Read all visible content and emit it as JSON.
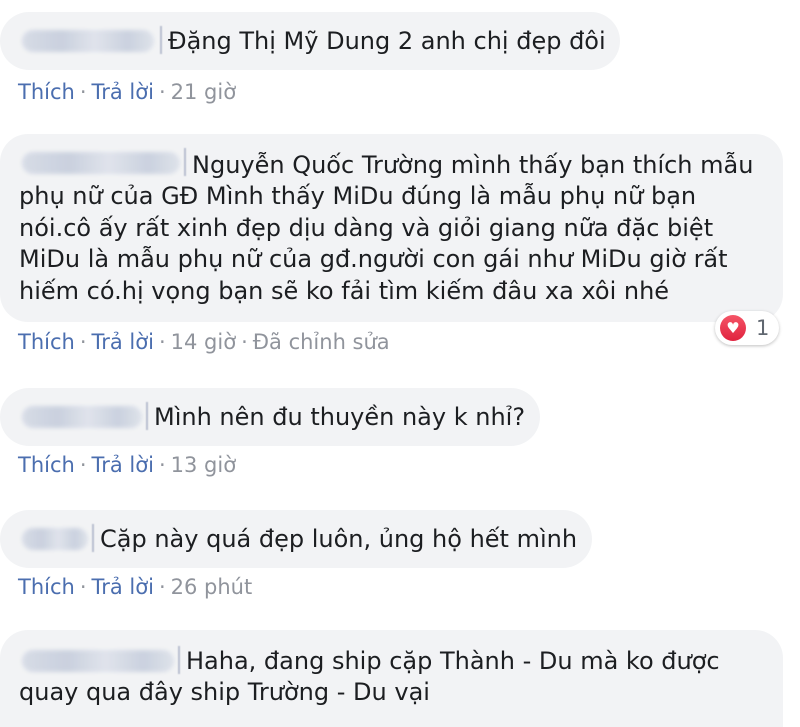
{
  "comments": [
    {
      "text": "Đặng Thị Mỹ Dung 2 anh chị đẹp đôi",
      "like": "Thích",
      "reply": "Trả lời",
      "time": "21 giờ"
    },
    {
      "lines": [
        "Nguyễn Quốc Trường mình thấy bạn thích mẫu",
        "phụ nữ của GĐ Mình thấy MiDu đúng là mẫu phụ nữ bạn",
        "nói.cô ấy rất xinh đẹp dịu dàng và giỏi giang nữa đặc biệt",
        "MiDu là mẫu phụ nữ của gđ.người con gái như MiDu giờ rất",
        "hiếm có.hị vọng bạn sẽ ko fải tìm kiếm đâu xa xôi nhé"
      ],
      "like": "Thích",
      "reply": "Trả lời",
      "time": "14 giờ",
      "edited": "Đã chỉnh sửa",
      "reaction": {
        "icon": "heart-icon",
        "count": "1",
        "color": "#e0223e"
      }
    },
    {
      "text": "Mình nên đu thuyền này k nhỉ?",
      "like": "Thích",
      "reply": "Trả lời",
      "time": "13 giờ"
    },
    {
      "text": "Cặp này quá đẹp luôn, ủng hộ hết mình",
      "like": "Thích",
      "reply": "Trả lời",
      "time": "26 phút"
    },
    {
      "lines": [
        "Haha, đang ship cặp Thành - Du mà ko được",
        "quay qua đây ship Trường - Du vại"
      ]
    }
  ],
  "colors": {
    "bubble": "#f2f3f5",
    "link": "#4b6eaf",
    "meta": "#90949c",
    "text": "#1c1e21"
  }
}
